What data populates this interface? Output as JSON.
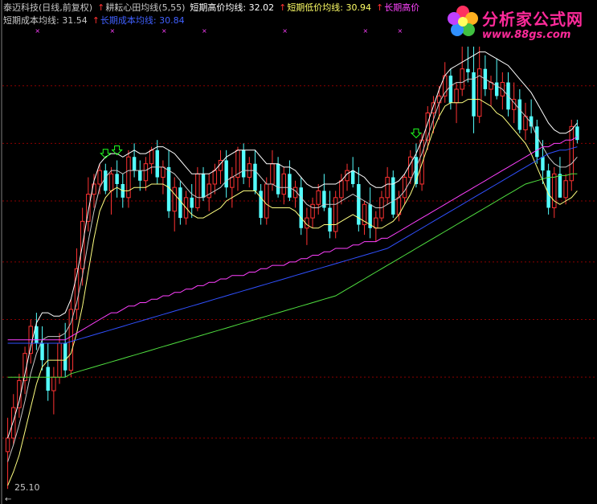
{
  "header": {
    "line1": [
      {
        "text": "泰迈科技(日线,前复权)",
        "color": "#c8c8c8"
      },
      {
        "text": "↑",
        "color": "#ff3030"
      },
      {
        "text": "耕耘心田均线(5,55)",
        "color": "#c8c8c8"
      },
      {
        "text": "短期高价均线: 32.02",
        "color": "#ffffff"
      },
      {
        "text": "↑",
        "color": "#ff3030"
      },
      {
        "text": "短期低价均线: 30.94",
        "color": "#ffff66"
      },
      {
        "text": "↑",
        "color": "#ff3030"
      },
      {
        "text": "长期高价",
        "color": "#ff44ff"
      }
    ],
    "line2": [
      {
        "text": "短期成本均线: 31.54",
        "color": "#c8c8c8"
      },
      {
        "text": "↑",
        "color": "#ff3030"
      },
      {
        "text": "长期成本均线: 30.84",
        "color": "#4060ff"
      }
    ]
  },
  "logo": {
    "name": "分析家公式网",
    "url": "www.88gs.com",
    "icon": "flower-logo-icon"
  },
  "bottom_label": "25.10",
  "colors": {
    "up": "#ff3232",
    "down": "#54ffff",
    "grid": "#8b0000",
    "short_high": "#ffffff",
    "short_low": "#ffff80",
    "short_cost": "#c8c8c8",
    "long_high": "#ff40ff",
    "long_cost": "#3050ff",
    "long_low": "#50e040",
    "signal": "#20ff20",
    "marker": "#ff40ff"
  },
  "chart_data": {
    "type": "candlestick",
    "ylim": [
      25.1,
      38.2
    ],
    "candles": [
      [
        26.1,
        27.1,
        25.0,
        26.5
      ],
      [
        26.5,
        27.8,
        26.3,
        27.4
      ],
      [
        27.4,
        28.4,
        27.1,
        28.2
      ],
      [
        28.2,
        29.2,
        27.8,
        29.0
      ],
      [
        29.0,
        30.0,
        28.7,
        29.8
      ],
      [
        29.8,
        30.2,
        29.1,
        29.3
      ],
      [
        29.3,
        29.8,
        28.5,
        28.8
      ],
      [
        28.6,
        29.3,
        27.6,
        27.9
      ],
      [
        27.9,
        28.6,
        27.2,
        28.3
      ],
      [
        28.3,
        29.6,
        28.1,
        29.3
      ],
      [
        29.3,
        29.9,
        28.3,
        28.5
      ],
      [
        28.5,
        30.6,
        28.3,
        30.3
      ],
      [
        30.3,
        32.1,
        30.0,
        31.5
      ],
      [
        31.5,
        33.3,
        31.0,
        32.9
      ],
      [
        32.9,
        34.2,
        32.6,
        33.7
      ],
      [
        33.7,
        34.3,
        33.3,
        34.0
      ],
      [
        34.0,
        34.6,
        33.7,
        34.4
      ],
      [
        34.4,
        34.6,
        33.7,
        33.8
      ],
      [
        33.8,
        34.5,
        33.1,
        34.3
      ],
      [
        34.3,
        34.7,
        33.6,
        34.0
      ],
      [
        34.0,
        34.3,
        33.3,
        33.6
      ],
      [
        33.6,
        35.0,
        33.3,
        34.8
      ],
      [
        34.8,
        35.2,
        34.2,
        34.4
      ],
      [
        34.4,
        34.7,
        33.8,
        34.1
      ],
      [
        34.1,
        34.8,
        33.8,
        34.6
      ],
      [
        34.6,
        35.1,
        34.3,
        35.0
      ],
      [
        35.0,
        35.3,
        34.0,
        34.2
      ],
      [
        34.2,
        34.7,
        33.7,
        34.5
      ],
      [
        34.5,
        35.0,
        33.0,
        33.2
      ],
      [
        33.2,
        34.2,
        32.6,
        33.9
      ],
      [
        33.9,
        34.1,
        32.8,
        33.0
      ],
      [
        33.0,
        33.8,
        32.8,
        33.6
      ],
      [
        33.6,
        34.0,
        33.0,
        33.3
      ],
      [
        33.3,
        34.5,
        33.2,
        34.3
      ],
      [
        34.3,
        34.5,
        33.5,
        33.6
      ],
      [
        33.6,
        34.3,
        33.2,
        34.0
      ],
      [
        34.0,
        34.6,
        33.7,
        34.4
      ],
      [
        34.4,
        35.0,
        34.0,
        34.7
      ],
      [
        34.7,
        35.0,
        33.6,
        33.9
      ],
      [
        33.9,
        34.5,
        33.3,
        34.2
      ],
      [
        34.2,
        35.1,
        33.8,
        35.0
      ],
      [
        35.0,
        35.2,
        34.0,
        34.2
      ],
      [
        34.2,
        34.8,
        33.9,
        34.6
      ],
      [
        34.6,
        35.0,
        33.7,
        33.8
      ],
      [
        33.8,
        34.0,
        32.8,
        33.0
      ],
      [
        33.0,
        34.2,
        32.8,
        34.0
      ],
      [
        34.0,
        35.0,
        33.8,
        34.6
      ],
      [
        34.6,
        34.8,
        33.6,
        33.7
      ],
      [
        33.7,
        34.5,
        33.4,
        34.3
      ],
      [
        34.3,
        34.7,
        33.5,
        33.6
      ],
      [
        33.6,
        34.1,
        33.3,
        33.9
      ],
      [
        33.9,
        34.2,
        32.5,
        32.7
      ],
      [
        32.7,
        33.3,
        32.2,
        33.0
      ],
      [
        33.0,
        33.6,
        32.7,
        33.4
      ],
      [
        33.4,
        34.0,
        33.1,
        33.8
      ],
      [
        33.8,
        34.3,
        33.2,
        33.3
      ],
      [
        33.3,
        33.8,
        32.4,
        32.6
      ],
      [
        32.6,
        33.8,
        32.4,
        33.6
      ],
      [
        33.6,
        34.3,
        33.4,
        34.1
      ],
      [
        34.1,
        34.6,
        33.8,
        34.4
      ],
      [
        34.4,
        34.8,
        33.9,
        34.0
      ],
      [
        34.0,
        34.5,
        32.6,
        32.8
      ],
      [
        32.8,
        33.5,
        32.5,
        33.4
      ],
      [
        33.4,
        33.9,
        32.4,
        32.7
      ],
      [
        32.7,
        33.2,
        32.3,
        33.0
      ],
      [
        33.0,
        33.8,
        32.9,
        33.6
      ],
      [
        33.6,
        34.5,
        33.4,
        34.2
      ],
      [
        34.2,
        34.4,
        33.0,
        33.1
      ],
      [
        33.1,
        33.8,
        32.9,
        33.6
      ],
      [
        33.6,
        34.3,
        33.4,
        34.2
      ],
      [
        34.2,
        35.0,
        34.0,
        34.8
      ],
      [
        34.8,
        35.2,
        33.9,
        34.0
      ],
      [
        34.0,
        35.5,
        33.8,
        35.3
      ],
      [
        35.3,
        36.3,
        35.0,
        36.1
      ],
      [
        36.1,
        36.6,
        35.5,
        36.4
      ],
      [
        36.4,
        36.9,
        35.9,
        36.6
      ],
      [
        36.6,
        37.6,
        36.4,
        37.2
      ],
      [
        37.2,
        37.4,
        36.2,
        36.4
      ],
      [
        36.4,
        37.0,
        35.8,
        36.8
      ],
      [
        36.8,
        38.2,
        36.6,
        37.4
      ],
      [
        37.4,
        38.2,
        37.0,
        37.3
      ],
      [
        37.3,
        38.2,
        35.5,
        36.0
      ],
      [
        36.0,
        38.2,
        35.8,
        37.4
      ],
      [
        37.4,
        37.8,
        36.6,
        36.8
      ],
      [
        36.8,
        37.2,
        36.3,
        37.0
      ],
      [
        37.0,
        37.7,
        36.5,
        36.6
      ],
      [
        36.6,
        37.3,
        36.2,
        37.0
      ],
      [
        37.0,
        37.3,
        36.0,
        36.2
      ],
      [
        36.2,
        37.0,
        35.8,
        36.5
      ],
      [
        36.5,
        36.8,
        35.5,
        35.6
      ],
      [
        35.6,
        36.4,
        35.3,
        36.0
      ],
      [
        36.0,
        36.5,
        35.5,
        35.7
      ],
      [
        35.7,
        35.9,
        34.6,
        34.8
      ],
      [
        34.8,
        35.3,
        34.0,
        34.4
      ],
      [
        34.4,
        34.6,
        33.1,
        33.3
      ],
      [
        33.3,
        34.5,
        33.0,
        34.3
      ],
      [
        34.3,
        34.8,
        33.6,
        33.6
      ],
      [
        33.6,
        34.3,
        33.4,
        34.1
      ],
      [
        34.1,
        35.9,
        33.8,
        35.7
      ],
      [
        35.7,
        35.9,
        35.2,
        35.3
      ]
    ],
    "series": [
      {
        "name": "短期高价均线",
        "values": [
          26.5,
          27.0,
          27.6,
          28.4,
          29.2,
          29.9,
          30.2,
          30.2,
          30.1,
          30.1,
          30.2,
          30.6,
          31.3,
          32.2,
          33.2,
          34.1,
          34.6,
          34.8,
          34.9,
          34.9,
          34.8,
          34.9,
          35.0,
          34.9,
          34.9,
          35.0,
          35.1,
          35.1,
          35.0,
          34.9,
          34.7,
          34.5,
          34.3,
          34.3,
          34.3,
          34.3,
          34.4,
          34.6,
          34.8,
          34.9,
          35.0,
          35.0,
          35.0,
          35.0,
          34.8,
          34.6,
          34.6,
          34.6,
          34.5,
          34.5,
          34.4,
          34.2,
          34.0,
          33.9,
          33.9,
          34.0,
          34.0,
          34.0,
          34.1,
          34.3,
          34.4,
          34.3,
          34.2,
          34.0,
          33.9,
          33.9,
          34.0,
          34.0,
          34.1,
          34.3,
          34.6,
          34.9,
          35.3,
          35.8,
          36.3,
          36.8,
          37.2,
          37.4,
          37.5,
          37.6,
          37.7,
          37.8,
          37.9,
          37.9,
          37.8,
          37.7,
          37.6,
          37.5,
          37.3,
          37.1,
          36.9,
          36.7,
          36.4,
          36.1,
          35.8,
          35.6,
          35.5,
          35.5,
          35.6,
          35.8
        ]
      },
      {
        "name": "短期低价均线",
        "values": [
          25.1,
          25.5,
          26.0,
          26.7,
          27.4,
          28.1,
          28.6,
          28.8,
          28.8,
          28.8,
          28.8,
          29.0,
          29.6,
          30.4,
          31.4,
          32.4,
          33.2,
          33.6,
          33.8,
          33.9,
          33.8,
          33.8,
          33.9,
          33.9,
          33.9,
          34.0,
          34.0,
          34.0,
          33.9,
          33.7,
          33.5,
          33.3,
          33.1,
          33.0,
          33.0,
          33.1,
          33.2,
          33.3,
          33.5,
          33.6,
          33.7,
          33.8,
          33.8,
          33.8,
          33.6,
          33.4,
          33.3,
          33.3,
          33.3,
          33.3,
          33.2,
          33.0,
          32.8,
          32.7,
          32.7,
          32.8,
          32.8,
          32.8,
          32.9,
          33.0,
          33.1,
          33.0,
          32.9,
          32.8,
          32.7,
          32.7,
          32.8,
          32.9,
          33.1,
          33.4,
          33.7,
          34.1,
          34.6,
          35.1,
          35.6,
          36.0,
          36.3,
          36.4,
          36.4,
          36.4,
          36.5,
          36.5,
          36.5,
          36.4,
          36.3,
          36.1,
          36.0,
          35.8,
          35.6,
          35.4,
          35.2,
          34.9,
          34.5,
          34.1,
          33.7,
          33.5,
          33.4,
          33.5,
          33.6,
          33.8
        ]
      },
      {
        "name": "短期成本均线",
        "values": [
          25.8,
          26.3,
          26.9,
          27.6,
          28.4,
          29.0,
          29.4,
          29.5,
          29.5,
          29.5,
          29.6,
          29.9,
          30.5,
          31.3,
          32.3,
          33.2,
          33.9,
          34.2,
          34.4,
          34.4,
          34.3,
          34.4,
          34.4,
          34.4,
          34.4,
          34.5,
          34.5,
          34.5,
          34.4,
          34.3,
          34.1,
          33.9,
          33.7,
          33.6,
          33.6,
          33.7,
          33.8,
          33.9,
          34.1,
          34.2,
          34.3,
          34.4,
          34.4,
          34.4,
          34.2,
          34.0,
          34.0,
          33.9,
          33.9,
          33.9,
          33.8,
          33.6,
          33.4,
          33.3,
          33.3,
          33.4,
          33.4,
          33.4,
          33.5,
          33.6,
          33.7,
          33.6,
          33.5,
          33.4,
          33.3,
          33.3,
          33.4,
          33.5,
          33.6,
          33.8,
          34.1,
          34.5,
          34.9,
          35.4,
          35.9,
          36.4,
          36.7,
          36.9,
          37.0,
          37.0,
          37.1,
          37.1,
          37.2,
          37.1,
          37.0,
          36.9,
          36.8,
          36.6,
          36.4,
          36.2,
          36.0,
          35.8,
          35.4,
          35.1,
          34.8,
          34.6,
          34.5,
          34.5,
          34.6,
          34.8
        ]
      },
      {
        "name": "长期高价",
        "values": [
          29.4,
          29.4,
          29.4,
          29.4,
          29.4,
          29.4,
          29.4,
          29.4,
          29.4,
          29.4,
          29.4,
          29.5,
          29.6,
          29.7,
          29.8,
          29.9,
          30.0,
          30.1,
          30.2,
          30.2,
          30.3,
          30.4,
          30.4,
          30.5,
          30.5,
          30.6,
          30.6,
          30.7,
          30.7,
          30.8,
          30.8,
          30.9,
          30.9,
          31.0,
          31.0,
          31.1,
          31.1,
          31.2,
          31.2,
          31.3,
          31.3,
          31.3,
          31.4,
          31.4,
          31.5,
          31.5,
          31.6,
          31.6,
          31.6,
          31.7,
          31.7,
          31.8,
          31.8,
          31.9,
          31.9,
          32.0,
          32.0,
          32.1,
          32.1,
          32.1,
          32.2,
          32.2,
          32.3,
          32.3,
          32.3,
          32.4,
          32.4,
          32.5,
          32.6,
          32.7,
          32.8,
          32.9,
          33.0,
          33.1,
          33.2,
          33.3,
          33.4,
          33.5,
          33.6,
          33.7,
          33.8,
          33.9,
          34.0,
          34.1,
          34.2,
          34.3,
          34.4,
          34.5,
          34.6,
          34.7,
          34.8,
          34.9,
          35.0,
          35.1,
          35.1,
          35.2,
          35.2,
          35.3,
          35.3,
          35.4
        ]
      },
      {
        "name": "长期成本均线",
        "values": [
          29.3,
          29.3,
          29.3,
          29.3,
          29.3,
          29.3,
          29.3,
          29.3,
          29.3,
          29.3,
          29.3,
          29.35,
          29.4,
          29.45,
          29.5,
          29.55,
          29.6,
          29.65,
          29.7,
          29.75,
          29.8,
          29.85,
          29.9,
          29.95,
          30.0,
          30.05,
          30.1,
          30.15,
          30.2,
          30.25,
          30.3,
          30.35,
          30.4,
          30.45,
          30.5,
          30.55,
          30.6,
          30.65,
          30.7,
          30.75,
          30.8,
          30.85,
          30.9,
          30.95,
          31.0,
          31.05,
          31.1,
          31.15,
          31.2,
          31.25,
          31.3,
          31.35,
          31.4,
          31.45,
          31.5,
          31.55,
          31.6,
          31.65,
          31.7,
          31.75,
          31.8,
          31.85,
          31.9,
          31.95,
          32.0,
          32.05,
          32.1,
          32.2,
          32.3,
          32.4,
          32.5,
          32.6,
          32.7,
          32.8,
          32.9,
          33.0,
          33.1,
          33.2,
          33.3,
          33.4,
          33.5,
          33.6,
          33.7,
          33.8,
          33.9,
          34.0,
          34.1,
          34.2,
          34.3,
          34.4,
          34.5,
          34.6,
          34.7,
          34.8,
          34.9,
          34.95,
          35.0,
          35.0,
          35.05,
          35.1
        ]
      },
      {
        "name": "长期低价",
        "values": [
          28.3,
          28.3,
          28.3,
          28.3,
          28.3,
          28.3,
          28.3,
          28.3,
          28.3,
          28.3,
          28.3,
          28.4,
          28.45,
          28.5,
          28.55,
          28.6,
          28.65,
          28.7,
          28.75,
          28.8,
          28.85,
          28.9,
          28.95,
          29.0,
          29.05,
          29.1,
          29.15,
          29.2,
          29.25,
          29.3,
          29.35,
          29.4,
          29.45,
          29.5,
          29.55,
          29.6,
          29.65,
          29.7,
          29.75,
          29.8,
          29.85,
          29.9,
          29.95,
          30.0,
          30.05,
          30.1,
          30.15,
          30.2,
          30.25,
          30.3,
          30.35,
          30.4,
          30.45,
          30.5,
          30.55,
          30.6,
          30.65,
          30.7,
          30.8,
          30.9,
          31.0,
          31.1,
          31.2,
          31.3,
          31.4,
          31.5,
          31.6,
          31.7,
          31.8,
          31.9,
          32.0,
          32.1,
          32.2,
          32.3,
          32.4,
          32.5,
          32.6,
          32.7,
          32.8,
          32.9,
          33.0,
          33.1,
          33.2,
          33.3,
          33.4,
          33.5,
          33.6,
          33.7,
          33.8,
          33.9,
          34.0,
          34.05,
          34.1,
          34.15,
          34.2,
          34.2,
          34.25,
          34.25,
          34.3,
          34.3
        ]
      }
    ],
    "signals": [
      17,
      19,
      71
    ],
    "markers_x": [
      5,
      18,
      27,
      34,
      48,
      62,
      68
    ],
    "grid_levels": [
      26.5,
      28.3,
      30.0,
      31.7,
      33.5,
      35.2,
      36.9
    ],
    "annotation": "25.10"
  }
}
